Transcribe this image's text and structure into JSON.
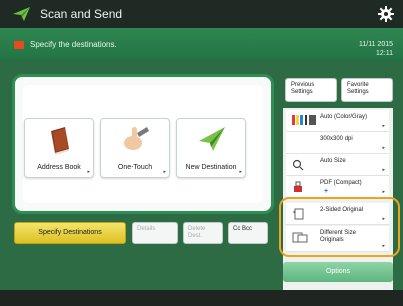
{
  "window": {
    "title": "Scan and Send"
  },
  "message": {
    "text": "Specify the destinations."
  },
  "datetime": {
    "date": "11/11 2015",
    "time": "12:11"
  },
  "destinations": [
    {
      "label": "Address Book",
      "icon": "address-book-icon"
    },
    {
      "label": "One-Touch",
      "icon": "one-touch-icon"
    },
    {
      "label": "New Destination",
      "icon": "new-destination-icon"
    }
  ],
  "left_controls": {
    "specify": "Specify Destinations",
    "details": "Details",
    "delete": "Delete Dest.",
    "cc": "Cc Bcc"
  },
  "right_panel": {
    "previous": "Previous Settings",
    "favorite": "Favorite Settings",
    "settings": [
      {
        "line1": "Auto (Color/Gray)",
        "line2": "",
        "icon": "color-mode-icon"
      },
      {
        "line1": "300x300 dpi",
        "line2": "",
        "icon": "resolution-icon"
      },
      {
        "line1": "Auto Size",
        "line2": "",
        "icon": "scan-size-icon"
      },
      {
        "line1": "PDF (Compact)",
        "line2": "",
        "icon": "file-format-icon"
      },
      {
        "line1": "2-Sided Original",
        "line2": "",
        "icon": "two-sided-icon"
      },
      {
        "line1": "Different Size",
        "line2": "Originals",
        "icon": "different-size-icon"
      }
    ],
    "options": "Options"
  },
  "colors": {
    "accent": "#2f8e52",
    "highlight": "#f0a21f",
    "specify_button": "#e8d13d"
  }
}
